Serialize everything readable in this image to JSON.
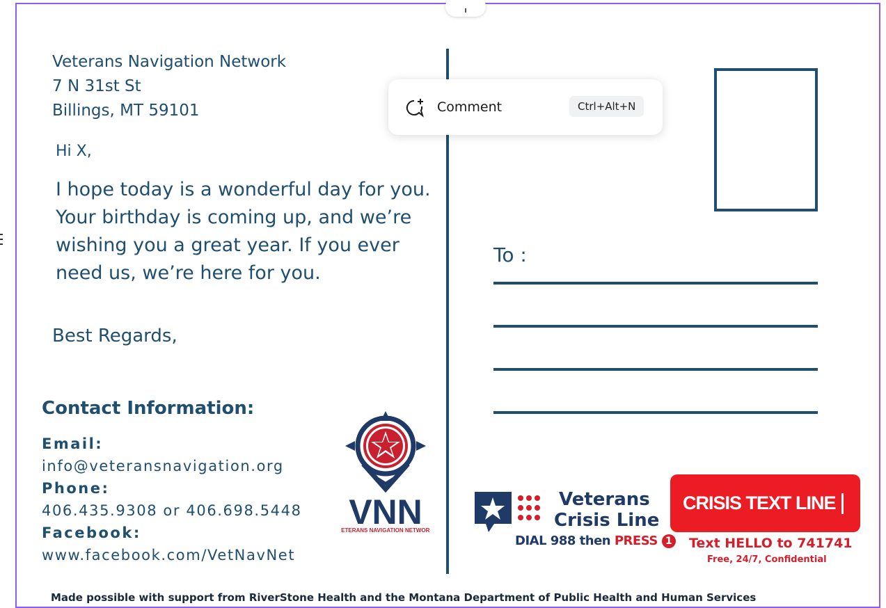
{
  "sender": {
    "line1": "Veterans Navigation Network",
    "line2": "7 N 31st St",
    "line3": "Billings, MT 59101"
  },
  "greeting": "Hi X,",
  "message": "I hope today is a wonderful day for you. Your birthday is coming up, and we’re wishing you a great year. If you ever need us, we’re here for you.",
  "signoff": "Best Regards,",
  "contact": {
    "title": "Contact Information:",
    "email_label": "Email:",
    "email": "info@veteransnavigation.org",
    "phone_label": "Phone:",
    "phone": "406.435.9308 or 406.698.5448",
    "facebook_label": "Facebook:",
    "facebook": "www.facebook.com/VetNavNet"
  },
  "logo": {
    "letters": "VNN",
    "subtitle": "VETERANS NAVIGATION NETWORK"
  },
  "recipient": {
    "to_label": "To :"
  },
  "comment_popup": {
    "label": "Comment",
    "shortcut": "Ctrl+Alt+N"
  },
  "crisis_line": {
    "title1": "Veterans",
    "title2": "Crisis Line",
    "dial_part1": "DIAL 988 then ",
    "dial_part2": "PRESS",
    "press_number": "1"
  },
  "crisis_text": {
    "title": "CRISIS TEXT LINE",
    "sms": "Text HELLO to 741741",
    "sub": "Free, 24/7, Confidential"
  },
  "footer": "Made possible with support from RiverStone Health and the Montana Department of Public Health and Human Services",
  "colors": {
    "navy": "#1f4e6e",
    "selection": "#8b5cf6",
    "crisis_red": "#ec1c24"
  }
}
